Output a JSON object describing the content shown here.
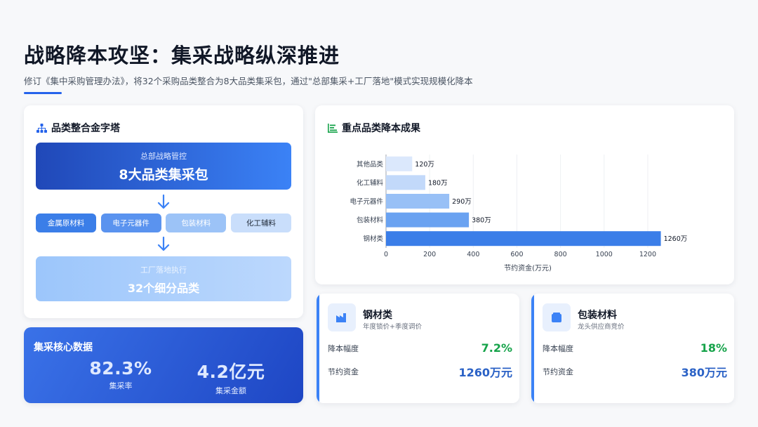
{
  "title": "战略降本攻坚：集采战略纵深推进",
  "subtitle": "修订《集中采购管理办法》，将32个采购品类整合为8大品类集采包，通过\"总部集采+工厂落地\"模式实现规模化降本",
  "pyramid": {
    "title": "品类整合金字塔",
    "top_small": "总部战略管控",
    "top_big": "8大品类集采包",
    "chips": [
      {
        "label": "金属原材料",
        "bg": "#3b7ee8",
        "fg": "#ffffff"
      },
      {
        "label": "电子元器件",
        "bg": "#5a93ef",
        "fg": "#ffffff"
      },
      {
        "label": "包装材料",
        "bg": "#9cc3f7",
        "fg": "#ffffff"
      },
      {
        "label": "化工辅料",
        "bg": "#c9defb",
        "fg": "#1f2937"
      }
    ],
    "bottom_small": "工厂落地执行",
    "bottom_big": "32个细分品类"
  },
  "core": {
    "title": "集采核心数据",
    "stats": [
      {
        "value": "82.3%",
        "label": "集采率"
      },
      {
        "value": "4.2亿元",
        "label": "集采金额"
      }
    ]
  },
  "chart_title": "重点品类降本成果",
  "chart_data": {
    "type": "bar",
    "orientation": "horizontal",
    "categories": [
      "其他品类",
      "化工辅料",
      "电子元器件",
      "包装材料",
      "钢材类"
    ],
    "values": [
      120,
      180,
      290,
      380,
      1260
    ],
    "value_labels": [
      "120万",
      "180万",
      "290万",
      "380万",
      "1260万"
    ],
    "bar_colors": [
      "#dbe8fc",
      "#c2d9fa",
      "#98c0f6",
      "#6aa2f1",
      "#3b7ee8"
    ],
    "xlabel": "节约资金(万元)",
    "ylabel": "",
    "xlim": [
      0,
      1300
    ],
    "xticks": [
      0,
      200,
      400,
      600,
      800,
      1000,
      1200
    ],
    "grid": "vertical"
  },
  "details": [
    {
      "name": "钢材类",
      "desc": "年度锁价+季度调价",
      "rate_label": "降本幅度",
      "rate": "7.2%",
      "save_label": "节约资金",
      "save": "1260万元",
      "icon": "factory-icon"
    },
    {
      "name": "包装材料",
      "desc": "龙头供应商竞价",
      "rate_label": "降本幅度",
      "rate": "18%",
      "save_label": "节约资金",
      "save": "380万元",
      "icon": "box-icon"
    }
  ]
}
